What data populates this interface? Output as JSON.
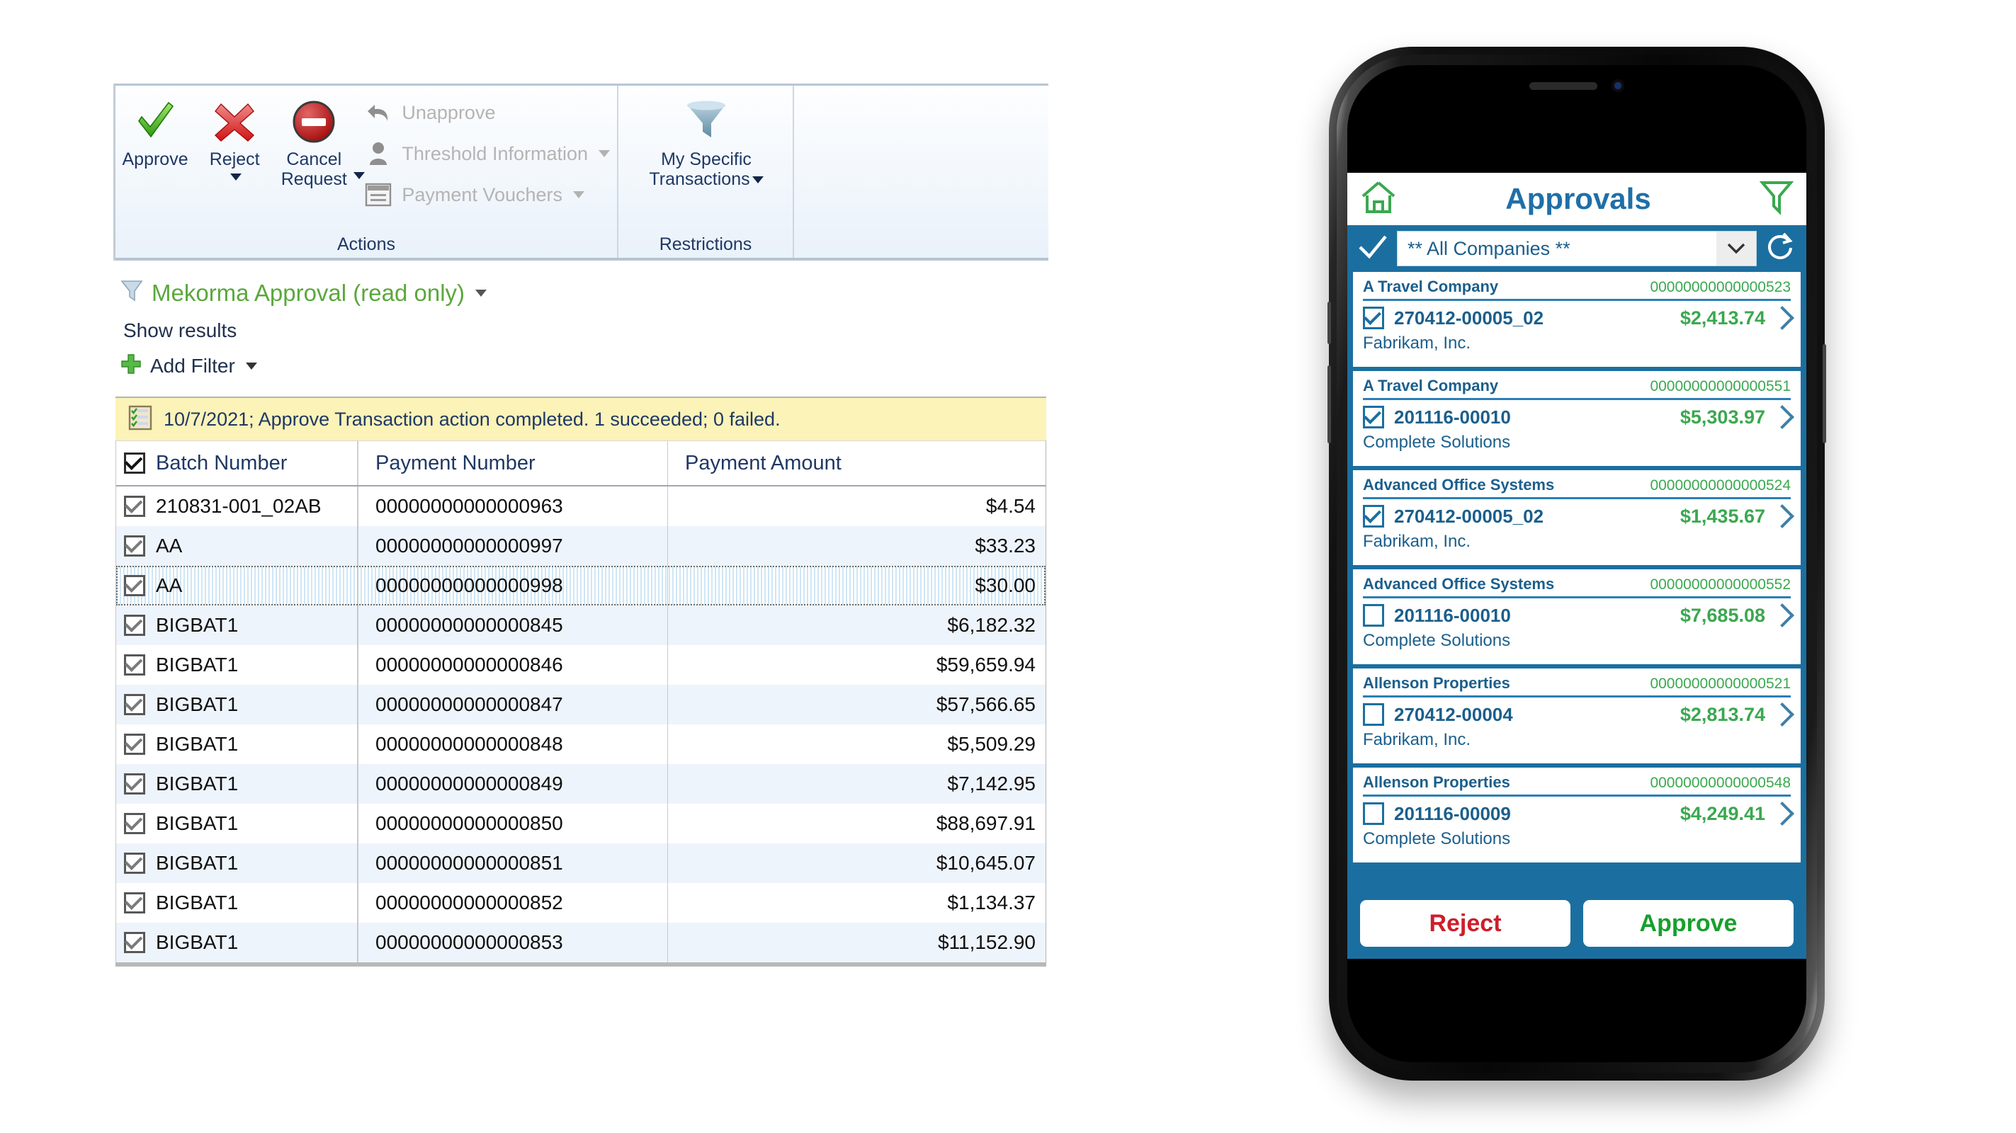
{
  "desktop": {
    "ribbon": {
      "groups": [
        {
          "label": "Actions",
          "big_buttons": [
            {
              "name": "approve",
              "label": "Approve",
              "icon": "green-check-icon",
              "has_caret": false
            },
            {
              "name": "reject",
              "label": "Reject",
              "icon": "red-x-icon",
              "has_caret": true
            },
            {
              "name": "cancel-request",
              "label": "Cancel Request",
              "icon": "red-no-entry-icon",
              "has_caret": true
            }
          ],
          "small_buttons": [
            {
              "name": "unapprove",
              "label": "Unapprove",
              "icon": "undo-arrow-icon",
              "disabled": true,
              "has_caret": false
            },
            {
              "name": "threshold-information",
              "label": "Threshold Information",
              "icon": "person-icon",
              "disabled": true,
              "has_caret": true
            },
            {
              "name": "payment-vouchers",
              "label": "Payment Vouchers",
              "icon": "voucher-window-icon",
              "disabled": true,
              "has_caret": true
            }
          ]
        },
        {
          "label": "Restrictions",
          "big_buttons": [
            {
              "name": "my-specific-transactions",
              "label": "My Specific Transactions",
              "icon": "funnel-icon",
              "has_caret": true
            }
          ],
          "small_buttons": []
        }
      ]
    },
    "filter": {
      "icon": "funnel-icon",
      "title": "Mekorma Approval (read only)",
      "show_results_label": "Show results",
      "add_filter_label": "Add Filter",
      "add_icon": "green-plus-icon"
    },
    "notification": {
      "icon": "checklist-icon",
      "text": "10/7/2021; Approve Transaction action completed. 1 succeeded; 0 failed."
    },
    "table": {
      "columns": [
        "Batch Number",
        "Payment Number",
        "Payment Amount"
      ],
      "header_checked": true,
      "rows": [
        {
          "checked": true,
          "batch": "210831-001_02AB",
          "payment": "00000000000000963",
          "amount": "$4.54",
          "selected": false
        },
        {
          "checked": true,
          "batch": "AA",
          "payment": "00000000000000997",
          "amount": "$33.23",
          "selected": false
        },
        {
          "checked": true,
          "batch": "AA",
          "payment": "00000000000000998",
          "amount": "$30.00",
          "selected": true
        },
        {
          "checked": true,
          "batch": "BIGBAT1",
          "payment": "00000000000000845",
          "amount": "$6,182.32",
          "selected": false
        },
        {
          "checked": true,
          "batch": "BIGBAT1",
          "payment": "00000000000000846",
          "amount": "$59,659.94",
          "selected": false
        },
        {
          "checked": true,
          "batch": "BIGBAT1",
          "payment": "00000000000000847",
          "amount": "$57,566.65",
          "selected": false
        },
        {
          "checked": true,
          "batch": "BIGBAT1",
          "payment": "00000000000000848",
          "amount": "$5,509.29",
          "selected": false
        },
        {
          "checked": true,
          "batch": "BIGBAT1",
          "payment": "00000000000000849",
          "amount": "$7,142.95",
          "selected": false
        },
        {
          "checked": true,
          "batch": "BIGBAT1",
          "payment": "00000000000000850",
          "amount": "$88,697.91",
          "selected": false
        },
        {
          "checked": true,
          "batch": "BIGBAT1",
          "payment": "00000000000000851",
          "amount": "$10,645.07",
          "selected": false
        },
        {
          "checked": true,
          "batch": "BIGBAT1",
          "payment": "00000000000000852",
          "amount": "$1,134.37",
          "selected": false
        },
        {
          "checked": true,
          "batch": "BIGBAT1",
          "payment": "00000000000000853",
          "amount": "$11,152.90",
          "selected": false
        }
      ]
    }
  },
  "phone": {
    "header": {
      "home_icon": "home-icon",
      "title": "Approvals",
      "filter_icon": "funnel-icon"
    },
    "subheader": {
      "select_all_icon": "check-icon",
      "company_value": "** All Companies **",
      "dropdown_icon": "chevron-down-icon",
      "refresh_icon": "refresh-icon"
    },
    "cards": [
      {
        "company": "A Travel Company",
        "number": "00000000000000523",
        "checked": true,
        "reference": "270412-00005_02",
        "amount": "$2,413.74",
        "vendor": "Fabrikam, Inc."
      },
      {
        "company": "A Travel Company",
        "number": "00000000000000551",
        "checked": true,
        "reference": "201116-00010",
        "amount": "$5,303.97",
        "vendor": "Complete Solutions"
      },
      {
        "company": "Advanced Office Systems",
        "number": "00000000000000524",
        "checked": true,
        "reference": "270412-00005_02",
        "amount": "$1,435.67",
        "vendor": "Fabrikam, Inc."
      },
      {
        "company": "Advanced Office Systems",
        "number": "00000000000000552",
        "checked": false,
        "reference": "201116-00010",
        "amount": "$7,685.08",
        "vendor": "Complete Solutions"
      },
      {
        "company": "Allenson Properties",
        "number": "00000000000000521",
        "checked": false,
        "reference": "270412-00004",
        "amount": "$2,813.74",
        "vendor": "Fabrikam, Inc."
      },
      {
        "company": "Allenson Properties",
        "number": "00000000000000548",
        "checked": false,
        "reference": "201116-00009",
        "amount": "$4,249.41",
        "vendor": "Complete Solutions"
      }
    ],
    "actions": {
      "reject_label": "Reject",
      "approve_label": "Approve"
    }
  },
  "colors": {
    "accent_blue": "#1b6fa0",
    "link_blue": "#1b5f8c",
    "money_green": "#3aa84f",
    "title_green": "#5aa83c",
    "reject_red": "#cc1f2a",
    "approve_green": "#17a02c",
    "notice_yellow": "#fbf3b8",
    "ribbon_text": "#1f3864"
  }
}
